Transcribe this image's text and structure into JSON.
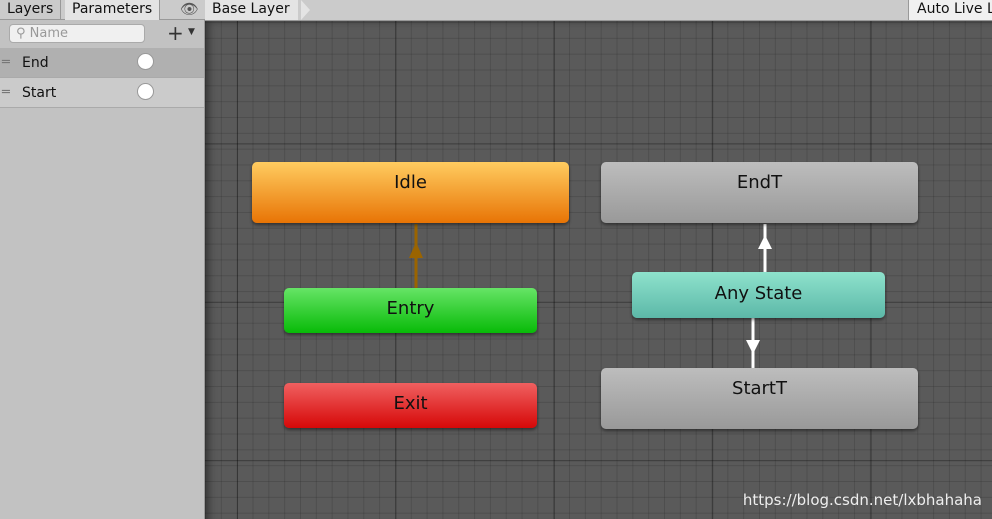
{
  "left_panel": {
    "tabs": [
      "Layers",
      "Parameters"
    ],
    "active_tab": "Parameters",
    "search_placeholder": "Name",
    "parameters": [
      {
        "name": "End",
        "type": "trigger",
        "selected": true
      },
      {
        "name": "Start",
        "type": "trigger",
        "selected": false
      }
    ]
  },
  "header": {
    "breadcrumb": "Base Layer",
    "auto_live": "Auto Live Link"
  },
  "graph": {
    "nodes": {
      "idle": {
        "label": "Idle",
        "color": "#f08f15"
      },
      "entry": {
        "label": "Entry",
        "color": "#1fcc1f"
      },
      "exit": {
        "label": "Exit",
        "color": "#dd1b1b"
      },
      "endt": {
        "label": "EndT",
        "color": "#a6a6a6"
      },
      "anystate": {
        "label": "Any State",
        "color": "#70d0bd"
      },
      "startt": {
        "label": "StartT",
        "color": "#a6a6a6"
      }
    },
    "transitions": [
      {
        "from": "Entry",
        "to": "Idle"
      },
      {
        "from": "Any State",
        "to": "EndT"
      },
      {
        "from": "Any State",
        "to": "StartT"
      }
    ]
  },
  "watermark": "https://blog.csdn.net/lxbhahaha"
}
